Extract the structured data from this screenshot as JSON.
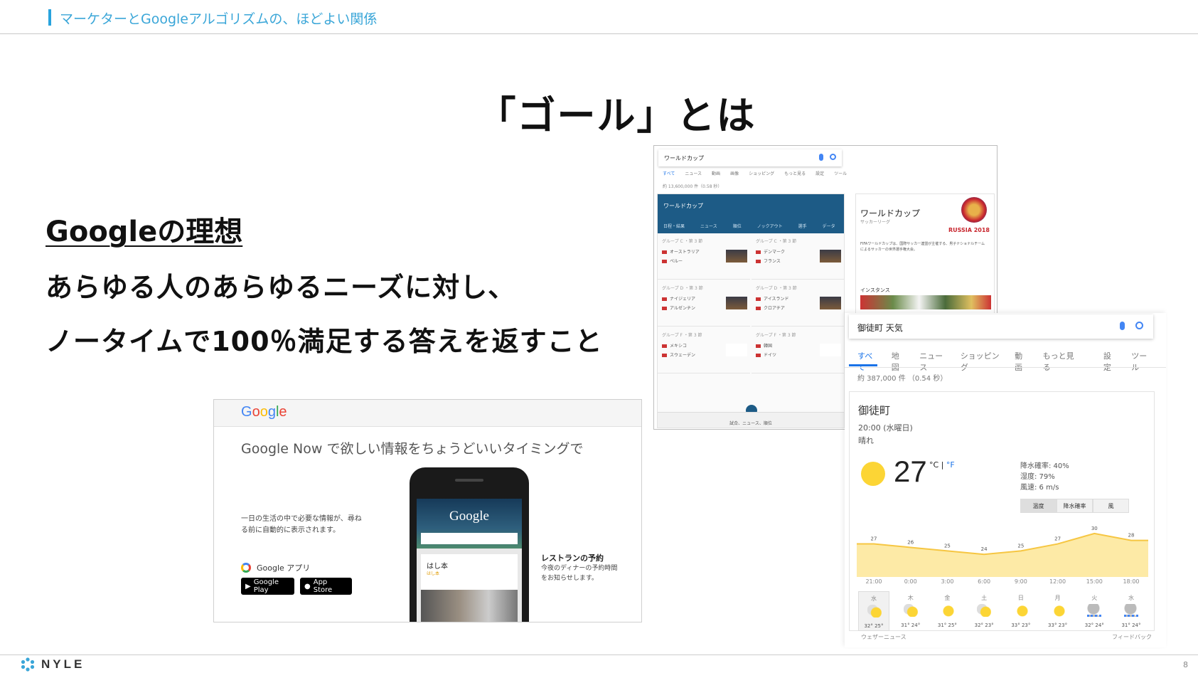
{
  "header": {
    "title": "マーケターとGoogleアルゴリズムの、ほどよい関係"
  },
  "slide": {
    "title": "「ゴール」とは",
    "ideal_heading": "Googleの理想",
    "ideal_lines": [
      "あらゆる人のあらゆるニーズに対し、",
      "ノータイムで100％満足する答えを返すこと"
    ]
  },
  "google_now": {
    "logo_letters": [
      "G",
      "o",
      "o",
      "g",
      "l",
      "e"
    ],
    "tagline": "Google Now で欲しい情報をちょうどいいタイミングで",
    "description": "一日の生活の中で必要な情報が、尋ねる前に自動的に表示されます。",
    "app_label": "Google アプリ",
    "play_label": "Google Play",
    "appstore_label": "App Store",
    "restaurant_title": "レストランの予約",
    "restaurant_desc": "今夜のディナーの予約時間をお知らせします。",
    "phone_logo": "Google",
    "phone_card_title": "はし本",
    "phone_card_sub": "はし本"
  },
  "worldcup": {
    "query": "ワールドカップ",
    "tabs": [
      "すべて",
      "ニュース",
      "動画",
      "画像",
      "ショッピング",
      "もっと見る",
      "設定",
      "ツール"
    ],
    "count": "約 13,600,000 件（0.58 秒）",
    "card_title": "ワールドカップ",
    "card_tabs": [
      "日程・結果",
      "ニュース",
      "順位",
      "ノックアウト",
      "選手",
      "データ"
    ],
    "matches": [
      {
        "group": "グループ C ・第 3 節",
        "team1": "オーストラリア",
        "team2": "ペルー"
      },
      {
        "group": "グループ C ・第 3 節",
        "team1": "デンマーク",
        "team2": "フランス"
      },
      {
        "group": "グループ D ・第 3 節",
        "team1": "ナイジェリア",
        "team2": "アルゼンチン"
      },
      {
        "group": "グループ D ・第 3 節",
        "team1": "アイスランド",
        "team2": "クロアチア"
      },
      {
        "group": "グループ F ・第 3 節",
        "team1": "メキシコ",
        "team2": "スウェーデン"
      },
      {
        "group": "グループ F ・第 3 節",
        "team1": "韓国",
        "team2": "ドイツ"
      }
    ],
    "card_footer": "試合、ニュース、順位",
    "kp_title": "ワールドカップ",
    "kp_sub": "サッカーリーグ",
    "kp_logo_text": "RUSSIA 2018",
    "kp_body": "FIFAワールドカップは、国際サッカー連盟が主催する、男子ナショナルチームによるサッカーの世界選手権大会。",
    "kp_instances": "インスタンス"
  },
  "weather": {
    "query": "御徒町 天気",
    "tabs": [
      "すべて",
      "地図",
      "ニュース",
      "ショッピング",
      "動画",
      "もっと見る",
      "設定",
      "ツール"
    ],
    "count": "約 387,000 件 （0.54 秒）",
    "location": "御徒町",
    "time": "20:00 (水曜日)",
    "condition": "晴れ",
    "temp": "27",
    "unit_c": "°C",
    "unit_sep": " | ",
    "unit_f": "°F",
    "precip": "降水確率: 40%",
    "humidity": "湿度: 79%",
    "wind": "風速: 6 m/s",
    "toggle": [
      "温度",
      "降水確率",
      "風"
    ],
    "hours": [
      "21:00",
      "0:00",
      "3:00",
      "6:00",
      "9:00",
      "12:00",
      "15:00",
      "18:00"
    ],
    "hourly_temps": [
      27,
      26,
      25,
      24,
      25,
      27,
      30,
      28
    ],
    "days": [
      {
        "name": "水",
        "icon": "partly-icon",
        "temp": "32° 25°"
      },
      {
        "name": "木",
        "icon": "partly-icon",
        "temp": "31° 24°"
      },
      {
        "name": "金",
        "icon": "sun-icon",
        "temp": "31° 25°"
      },
      {
        "name": "土",
        "icon": "partly-icon",
        "temp": "32° 23°"
      },
      {
        "name": "日",
        "icon": "sun-icon",
        "temp": "33° 23°"
      },
      {
        "name": "月",
        "icon": "sun-icon",
        "temp": "33° 23°"
      },
      {
        "name": "火",
        "icon": "rain-icon",
        "temp": "32° 24°"
      },
      {
        "name": "水",
        "icon": "rain-icon",
        "temp": "31° 24°"
      }
    ],
    "footer_left": "ウェザーニュース",
    "footer_right": "フィードバック",
    "colors": {
      "line": "#f6c642",
      "fill": "#fdeaa6"
    }
  },
  "footer": {
    "brand": "NYLE",
    "page": "8"
  }
}
